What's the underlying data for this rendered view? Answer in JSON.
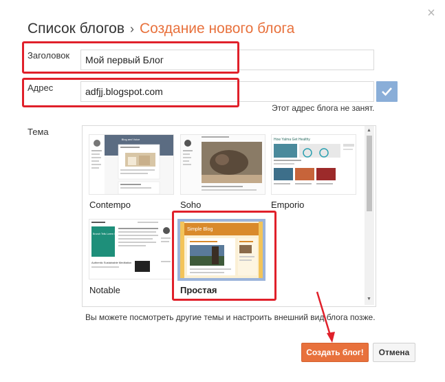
{
  "dialog": {
    "breadcrumb_parent": "Список блогов",
    "breadcrumb_separator": "›",
    "breadcrumb_current": "Создание нового блога",
    "close_icon": "close-icon"
  },
  "form": {
    "title_label": "Заголовок",
    "title_value": "Мой первый Блог",
    "address_label": "Адрес",
    "address_value": "adfjj.blogspot.com",
    "address_status": "Этот адрес блога не занят.",
    "theme_label": "Тема"
  },
  "themes": [
    {
      "name": "Contempo",
      "selected": false
    },
    {
      "name": "Soho",
      "selected": false
    },
    {
      "name": "Emporio",
      "selected": false
    },
    {
      "name": "Notable",
      "selected": false
    },
    {
      "name": "Простая",
      "selected": true
    }
  ],
  "thumb_text": {
    "contempo_header": "Blog and Voice",
    "emporio_header": "How Yalma Get Healthy",
    "notable_title": "Brunch Tells Lorem Ipsum Wonderful Moments",
    "notable_sub": "Authentic Sustainable Meditation",
    "simple_header": "Simple Blog"
  },
  "footer": {
    "hint": "Вы можете посмотреть другие темы и настроить внешний вид блога позже.",
    "create_label": "Создать блог!",
    "cancel_label": "Отмена"
  },
  "colors": {
    "accent": "#e8713c",
    "highlight": "#e0202a",
    "check_button": "#8aaed8"
  }
}
